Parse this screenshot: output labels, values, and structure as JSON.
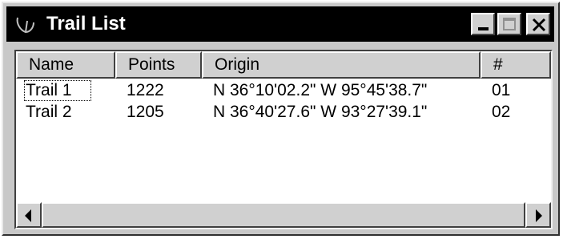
{
  "window": {
    "title": "Trail List",
    "title_icon": "trail-path-icon",
    "controls": {
      "minimize_icon": "minimize-icon",
      "maximize_icon": "maximize-icon",
      "close_icon": "close-icon"
    }
  },
  "list": {
    "columns": [
      "Name",
      "Points",
      "Origin",
      "#"
    ],
    "rows": [
      {
        "name": "Trail 1",
        "points": "1222",
        "origin": "N 36°10'02.2\" W  95°45'38.7\"",
        "num": "01",
        "focused": true
      },
      {
        "name": "Trail 2",
        "points": "1205",
        "origin": "N 36°40'27.6\" W  93°27'39.1\"",
        "num": "02",
        "focused": false
      }
    ]
  },
  "scrollbar": {
    "left_icon": "scroll-left-arrow-icon",
    "right_icon": "scroll-right-arrow-icon"
  },
  "colors": {
    "titlebar": "#000000",
    "face": "#c8c8c8",
    "list_background": "#ffffff"
  }
}
